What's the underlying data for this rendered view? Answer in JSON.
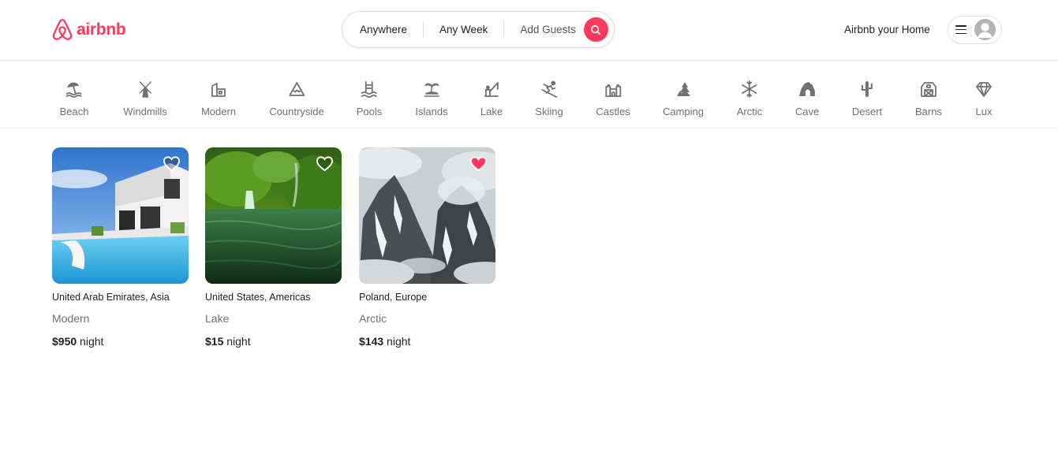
{
  "brand": {
    "name": "airbnb",
    "color": "#ff385c"
  },
  "search": {
    "anywhere": "Anywhere",
    "any_week": "Any Week",
    "add_guests": "Add Guests",
    "icon": "search-icon"
  },
  "header": {
    "host_link": "Airbnb your Home",
    "menu_icon": "hamburger-icon",
    "avatar_icon": "user-avatar-icon"
  },
  "categories": [
    {
      "label": "Beach",
      "icon": "beach-icon"
    },
    {
      "label": "Windmills",
      "icon": "windmill-icon"
    },
    {
      "label": "Modern",
      "icon": "modern-house-icon"
    },
    {
      "label": "Countryside",
      "icon": "mountain-icon"
    },
    {
      "label": "Pools",
      "icon": "pool-icon"
    },
    {
      "label": "Islands",
      "icon": "island-icon"
    },
    {
      "label": "Lake",
      "icon": "fishing-icon"
    },
    {
      "label": "Skiing",
      "icon": "skier-icon"
    },
    {
      "label": "Castles",
      "icon": "castle-icon"
    },
    {
      "label": "Camping",
      "icon": "campfire-icon"
    },
    {
      "label": "Arctic",
      "icon": "snowflake-icon"
    },
    {
      "label": "Cave",
      "icon": "cave-icon"
    },
    {
      "label": "Desert",
      "icon": "cactus-icon"
    },
    {
      "label": "Barns",
      "icon": "barn-icon"
    },
    {
      "label": "Lux",
      "icon": "diamond-icon"
    }
  ],
  "listings": [
    {
      "location": "United Arab Emirates, Asia",
      "category": "Modern",
      "price": "$950",
      "unit": "night",
      "favorited": false
    },
    {
      "location": "United States, Americas",
      "category": "Lake",
      "price": "$15",
      "unit": "night",
      "favorited": false
    },
    {
      "location": "Poland, Europe",
      "category": "Arctic",
      "price": "$143",
      "unit": "night",
      "favorited": true
    }
  ],
  "colors": {
    "accent": "#ff385c",
    "muted_text": "#717171",
    "text": "#222222",
    "border": "#dddddd",
    "icon": "#717171"
  }
}
